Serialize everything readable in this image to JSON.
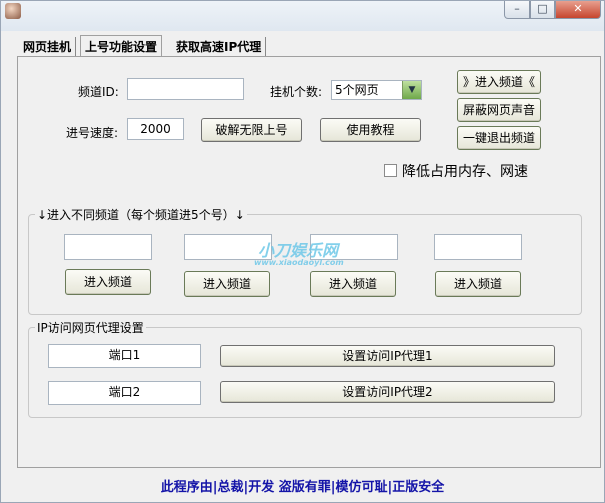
{
  "window": {
    "min_glyph": "–",
    "max_glyph": "□",
    "close_glyph": "✕"
  },
  "tabs": [
    "网页挂机",
    "上号功能设置",
    "获取高速IP代理"
  ],
  "form": {
    "channel_id_label": "频道ID:",
    "channel_id_value": "",
    "hang_count_label": "挂机个数:",
    "hang_count_selected": "5个网页",
    "speed_label": "进号速度:",
    "speed_value": "2000",
    "crack_button": "破解无限上号",
    "tutorial_button": "使用教程"
  },
  "right_buttons": {
    "enter_channel": "》进入频道《",
    "mute": "屏蔽网页声音",
    "exit_all": "一键退出频道"
  },
  "reduce_checkbox": {
    "label": "降低占用内存、网速",
    "checked": false
  },
  "multi_group": {
    "title": "↓进入不同频道（每个频道进5个号）↓",
    "inputs": [
      "",
      "",
      "",
      ""
    ],
    "buttons": [
      "进入频道",
      "进入频道",
      "进入频道",
      "进入频道"
    ]
  },
  "watermark": {
    "line1": "小刀娱乐网",
    "line2": "www.xiaodaoyl.com"
  },
  "proxy_group": {
    "title": "IP访问网页代理设置",
    "port1": "端口1",
    "port2": "端口2",
    "set1_button": "设置访问IP代理1",
    "set2_button": "设置访问IP代理2"
  },
  "footer": "此程序由|总裁|开发 盗版有罪|模仿可耻|正版安全"
}
